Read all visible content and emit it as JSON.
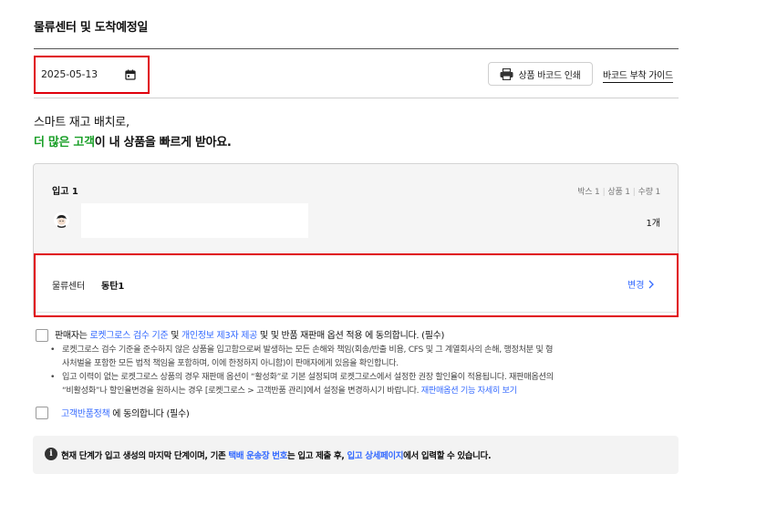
{
  "section": {
    "title": "물류센터 및 도착예정일"
  },
  "date_field": {
    "value": "2025-05-13",
    "icon": "calendar-icon"
  },
  "toolbar": {
    "print_label": "상품 바코드 인쇄",
    "print_icon": "printer-icon",
    "guide_label": "바코드 부착 가이드"
  },
  "promo": {
    "line1": "스마트 재고 배치로,",
    "line2_highlight": "더 많은 고객",
    "line2_rest": "이 내 상품을 빠르게 받아요.",
    "highlight_color": "#1a9f28"
  },
  "inbound": {
    "title": "입고 1",
    "summary": [
      {
        "label": "박스",
        "value": "1"
      },
      {
        "label": "상품",
        "value": "1"
      },
      {
        "label": "수량",
        "value": "1"
      }
    ],
    "item_qty": "1개",
    "item_name": ""
  },
  "center": {
    "label": "물류센터",
    "value": "동탄1",
    "change_label": "변경",
    "change_icon": "chevron-right-icon"
  },
  "agreements": {
    "main": {
      "prefix": "판매자는 ",
      "link1": "로켓그로스 검수 기준",
      "and1": " 및 ",
      "link2": "개인정보 제3자 제공",
      "suffix": " 및 및 반품 재판매 옵션 적용 에 동의합니다. (필수)",
      "checked": false
    },
    "bullets": [
      {
        "text": "로켓그로스 검수 기준을 준수하지 않은 상품을 입고함으로써 발생하는 모든 손해와 책임(회송/반출 비용, CFS 및 그 계열회사의 손해, 행정처분 및 형",
        "text2": "사처벌을 포함한 모든 법적 책임을 포함하며, 이에 한정하지 아니함)이 판매자에게 있음을 확인합니다."
      },
      {
        "text": "입고 이력이 없는 로켓그로스 상품의 경우 재판매 옵션이 “활성화”로 기본 설정되며 로켓그로스에서 설정한 권장 할인율이 적용됩니다. 재판매옵션의",
        "text2": "“비활성화”나 할인율변경을 원하시는 경우 [로켓그로스 > 고객반품 관리]에서 설정을 변경하시기 바랍니다. ",
        "link": "재판매옵션 기능 자세히 보기"
      }
    ],
    "return_policy": {
      "link": "고객반품정책",
      "suffix": " 에 동의합니다 (필수)",
      "checked": false
    }
  },
  "notice": {
    "icon": "info-icon",
    "part1": "현재 단계가 입고 생성의 마지막 단계이며, 기존 ",
    "link1": "택배 운송장 번호",
    "part2": "는 입고 제출 후, ",
    "link2": "입고 상세페이지",
    "part3": "에서 입력할 수 있습니다."
  }
}
